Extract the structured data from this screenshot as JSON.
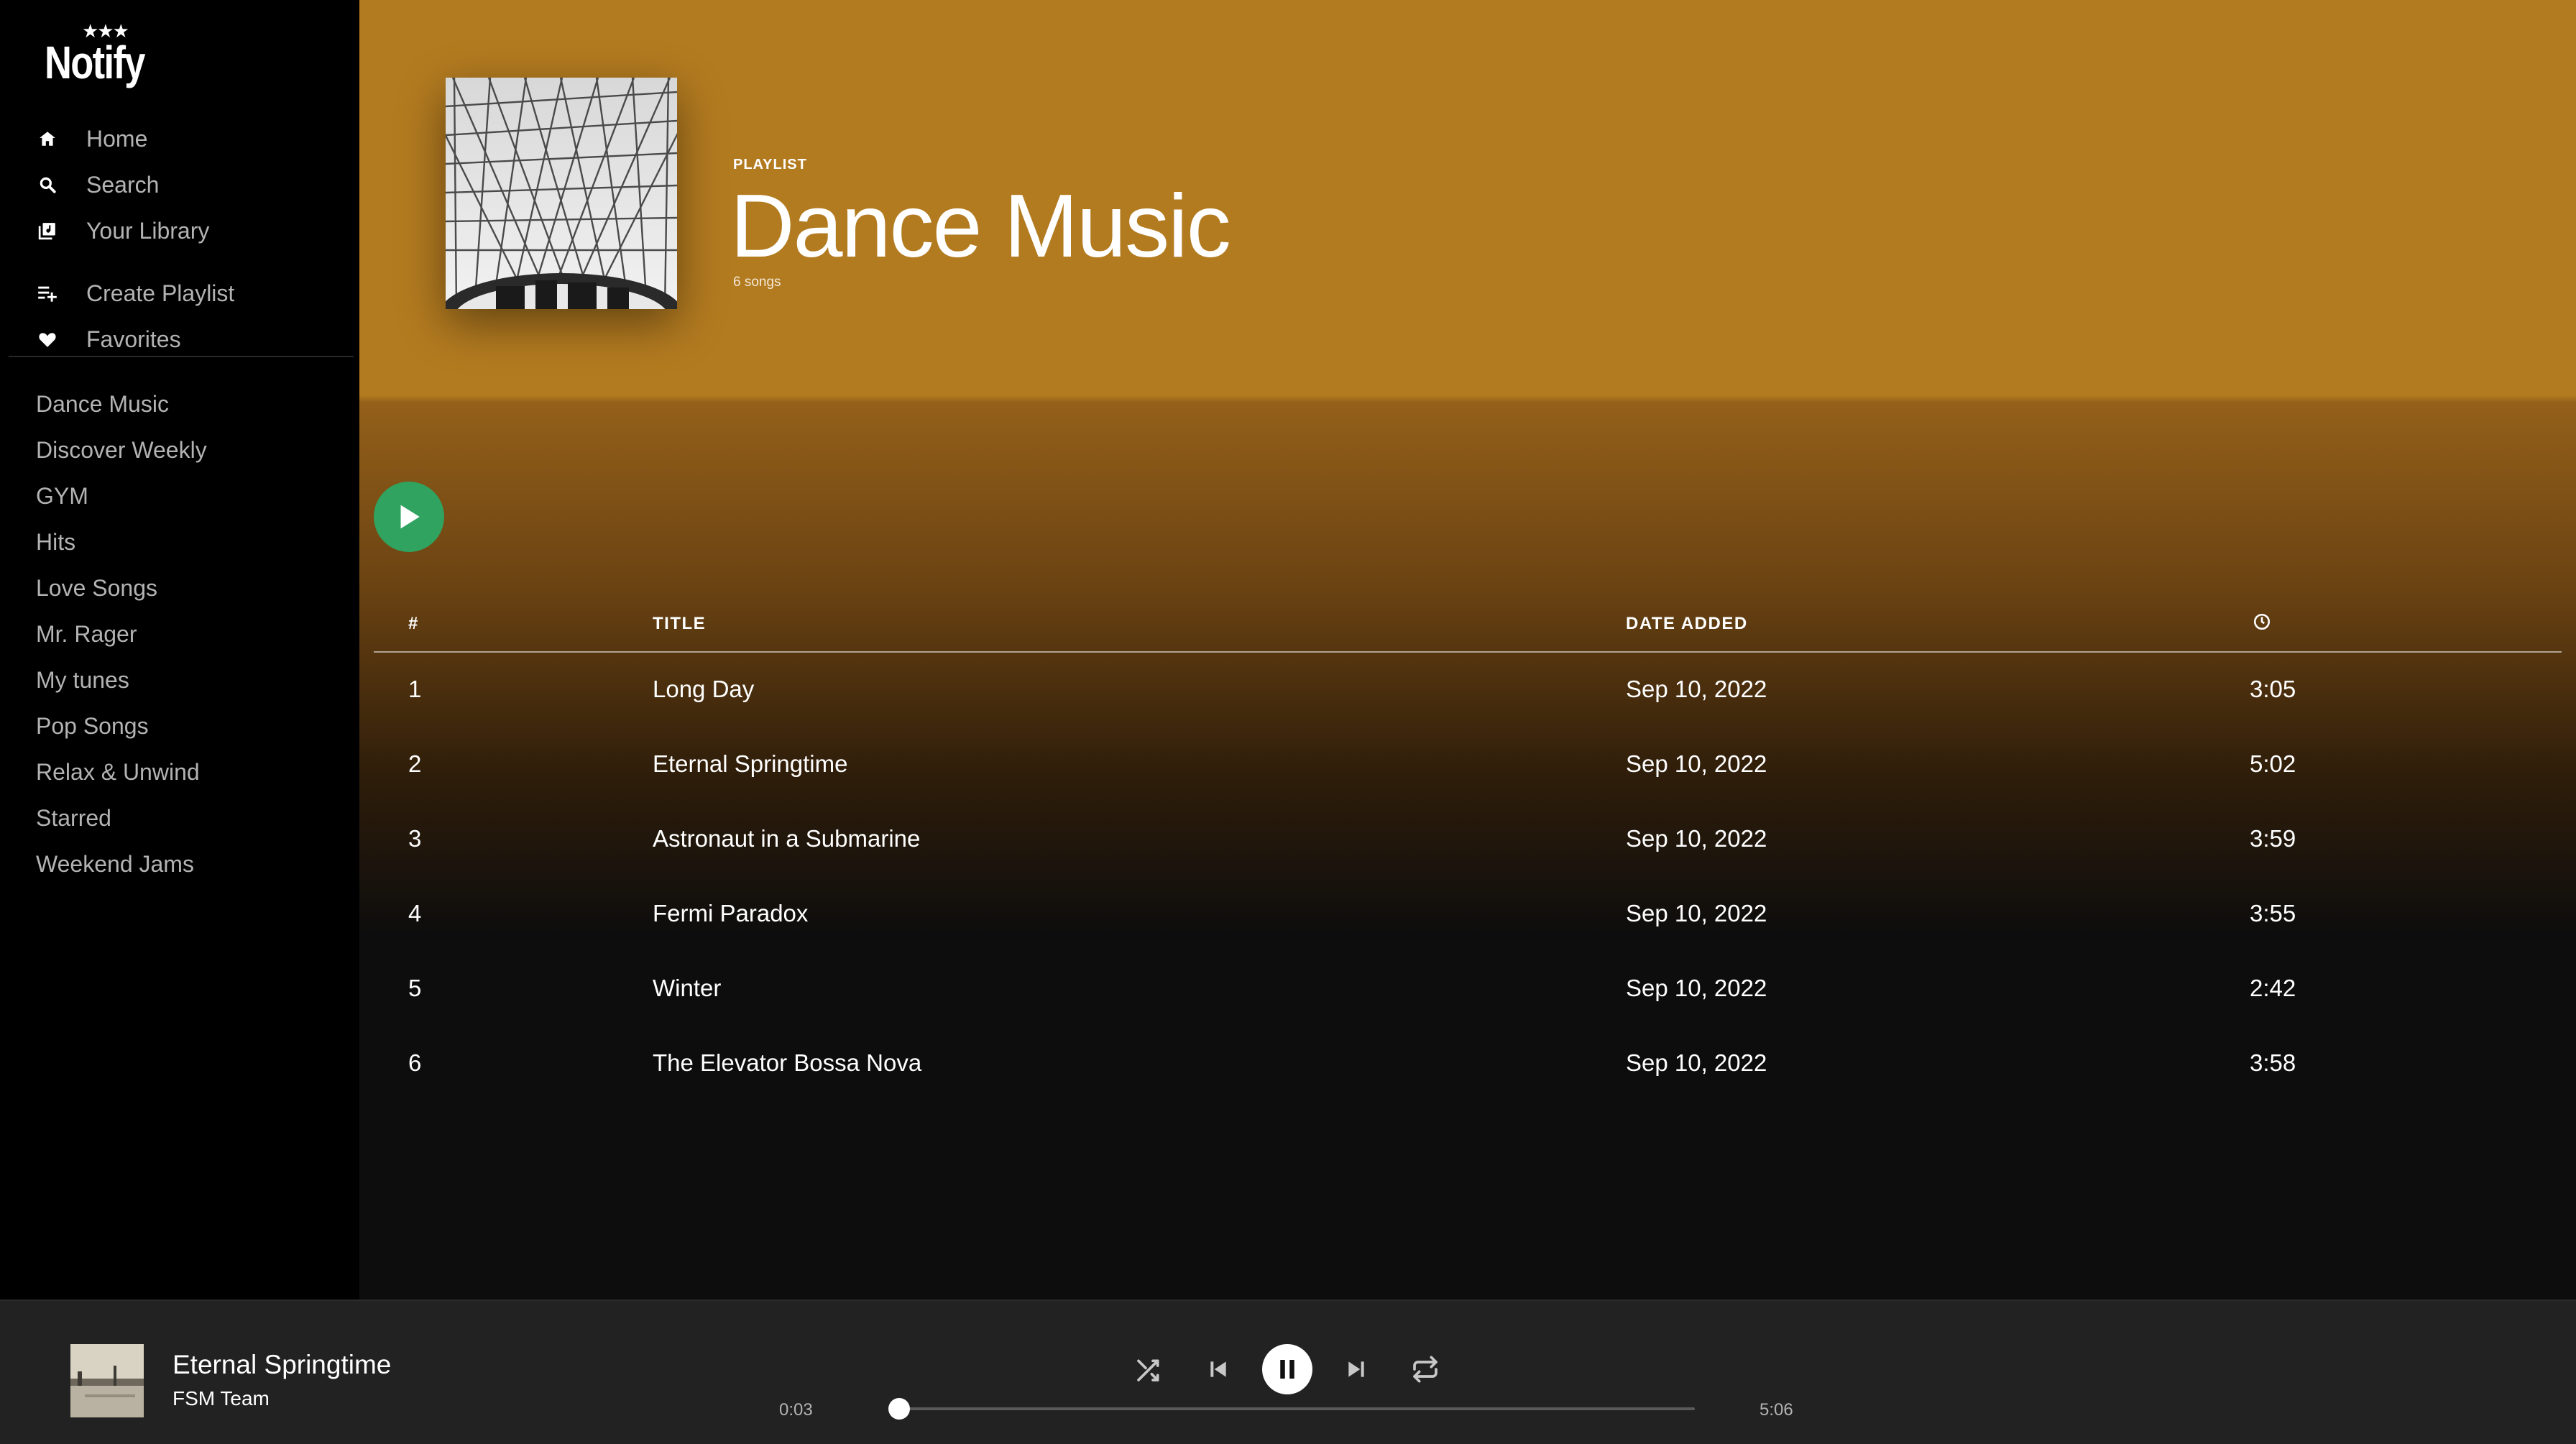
{
  "app": {
    "name": "Notify",
    "logo_stars": "★★★"
  },
  "sidebar": {
    "nav": [
      {
        "label": "Home",
        "icon": "home-icon"
      },
      {
        "label": "Search",
        "icon": "search-icon"
      },
      {
        "label": "Your Library",
        "icon": "library-icon"
      },
      {
        "label": "Create Playlist",
        "icon": "add-to-playlist-icon"
      },
      {
        "label": "Favorites",
        "icon": "heart-icon"
      }
    ],
    "playlists": [
      "Dance Music",
      "Discover Weekly",
      "GYM",
      "Hits",
      "Love Songs",
      "Mr. Rager",
      "My tunes",
      "Pop Songs",
      "Relax & Unwind",
      "Starred",
      "Weekend Jams"
    ]
  },
  "header": {
    "type_label": "PLAYLIST",
    "title": "Dance Music",
    "song_count": "6 songs",
    "accent_color": "#b37b20"
  },
  "table": {
    "columns": {
      "index": "#",
      "title": "TITLE",
      "date_added": "DATE ADDED",
      "duration_icon": "clock-icon"
    },
    "rows": [
      {
        "index": "1",
        "title": "Long Day",
        "date": "Sep 10, 2022",
        "duration": "3:05"
      },
      {
        "index": "2",
        "title": "Eternal Springtime",
        "date": "Sep 10, 2022",
        "duration": "5:02"
      },
      {
        "index": "3",
        "title": "Astronaut in a Submarine",
        "date": "Sep 10, 2022",
        "duration": "3:59"
      },
      {
        "index": "4",
        "title": "Fermi Paradox",
        "date": "Sep 10, 2022",
        "duration": "3:55"
      },
      {
        "index": "5",
        "title": "Winter",
        "date": "Sep 10, 2022",
        "duration": "2:42"
      },
      {
        "index": "6",
        "title": "The Elevator Bossa Nova",
        "date": "Sep 10, 2022",
        "duration": "3:58"
      }
    ]
  },
  "player": {
    "title": "Eternal Springtime",
    "artist": "FSM Team",
    "elapsed": "0:03",
    "total": "5:06",
    "progress_fraction": 0.01,
    "play_button_color": "#2fa35f"
  }
}
